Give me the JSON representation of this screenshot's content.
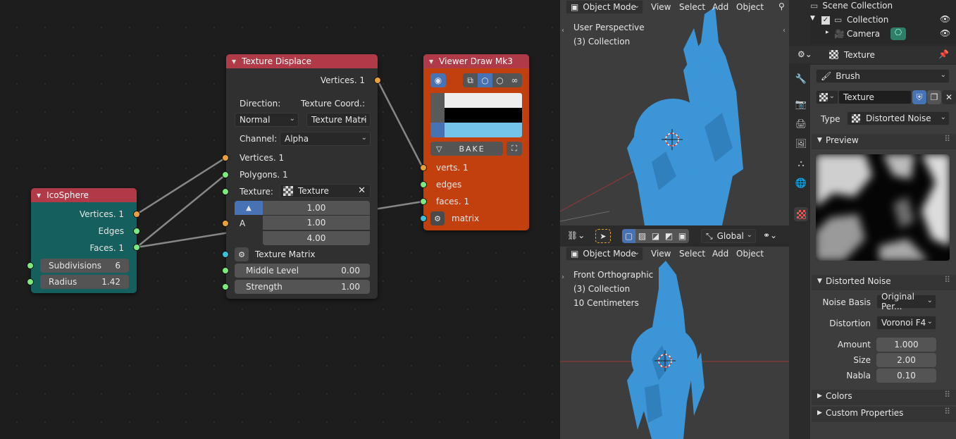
{
  "node_editor": {
    "icosphere": {
      "title": "IcoSphere",
      "out_vertices": "Vertices. 1",
      "out_edges": "Edges",
      "out_faces": "Faces. 1",
      "subdiv_label": "Subdivisions",
      "subdiv_value": "6",
      "radius_label": "Radius",
      "radius_value": "1.42"
    },
    "texture_displace": {
      "title": "Texture Displace",
      "out_vertices": "Vertices. 1",
      "direction_label": "Direction:",
      "coord_label": "Texture Coord.:",
      "direction_value": "Normal",
      "coord_value": "Texture Matri",
      "channel_label": "Channel:",
      "channel_value": "Alpha",
      "in_vertices": "Vertices. 1",
      "in_polygons": "Polygons. 1",
      "texture_label": "Texture:",
      "texture_value": "Texture",
      "vec_x": "1.00",
      "vec_a_label": "A",
      "vec_y": "1.00",
      "vec_z": "4.00",
      "matrix_label": "Texture Matrix",
      "mid_label": "Middle Level",
      "mid_value": "0.00",
      "strength_label": "Strength",
      "strength_value": "1.00"
    },
    "viewer": {
      "title": "Viewer Draw Mk3",
      "bake_label": "BAKE",
      "in_verts": "verts. 1",
      "in_edges": "edges",
      "in_faces": "faces. 1",
      "in_matrix": "matrix",
      "color_vert": "#eeeeee",
      "color_edge": "#000000",
      "color_face": "#74c4ea"
    }
  },
  "viewport_top": {
    "mode": "Object Mode",
    "menu": [
      "View",
      "Select",
      "Add",
      "Object"
    ],
    "perspective": "User Perspective",
    "collection": "(3) Collection"
  },
  "viewport_toolbar": {
    "orientation": "Global"
  },
  "viewport_bottom": {
    "mode": "Object Mode",
    "menu": [
      "View",
      "Select",
      "Add",
      "Object"
    ],
    "perspective": "Front Orthographic",
    "collection": "(3) Collection",
    "scale": "10 Centimeters"
  },
  "outliner": {
    "scene_collection": "Scene Collection",
    "collection": "Collection",
    "camera": "Camera"
  },
  "properties": {
    "header": "Texture",
    "brush": "Brush",
    "texture_name": "Texture",
    "type_label": "Type",
    "type_value": "Distorted Noise",
    "preview_label": "Preview",
    "noise_panel": "Distorted Noise",
    "noise_basis_label": "Noise Basis",
    "noise_basis_value": "Original Per...",
    "distortion_label": "Distortion",
    "distortion_value": "Voronoi F4",
    "amount_label": "Amount",
    "amount_value": "1.000",
    "size_label": "Size",
    "size_value": "2.00",
    "nabla_label": "Nabla",
    "nabla_value": "0.10",
    "colors_label": "Colors",
    "custom_label": "Custom Properties"
  },
  "colors": {
    "node_header_red": "#b13a48",
    "icosphere_body": "#15605e",
    "viewer_body": "#c2400d",
    "mesh_blue": "#3b95d6",
    "accent_blue": "#4772b3"
  }
}
